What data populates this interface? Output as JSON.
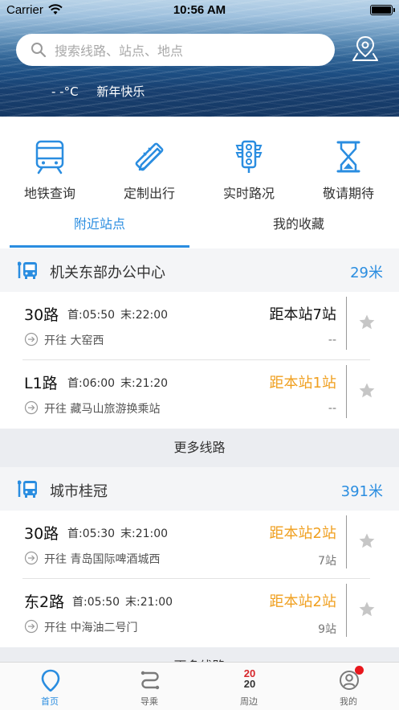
{
  "status_bar": {
    "carrier": "Carrier",
    "time": "10:56 AM"
  },
  "header": {
    "search_placeholder": "搜索线路、站点、地点",
    "temperature": "- -°C",
    "greeting": "新年快乐"
  },
  "quick_actions": [
    {
      "label": "地铁查询",
      "icon": "subway-icon"
    },
    {
      "label": "定制出行",
      "icon": "ruler-pencil-icon"
    },
    {
      "label": "实时路况",
      "icon": "traffic-light-icon"
    },
    {
      "label": "敬请期待",
      "icon": "hourglass-icon"
    }
  ],
  "tabs": [
    {
      "label": "附近站点",
      "active": true
    },
    {
      "label": "我的收藏",
      "active": false
    }
  ],
  "stations": [
    {
      "name": "机关东部办公中心",
      "distance": "29米",
      "routes": [
        {
          "name": "30路",
          "first_prefix": "首:",
          "first": "05:50",
          "last_prefix": "末:",
          "last": "22:00",
          "direction_prefix": "开往",
          "direction": "大窑西",
          "away": "距本站7站",
          "away_color": "black",
          "stops": "--"
        },
        {
          "name": "L1路",
          "first_prefix": "首:",
          "first": "06:00",
          "last_prefix": "末:",
          "last": "21:20",
          "direction_prefix": "开往",
          "direction": "藏马山旅游换乘站",
          "away": "距本站1站",
          "away_color": "orange",
          "stops": "--"
        }
      ],
      "more_label": "更多线路"
    },
    {
      "name": "城市桂冠",
      "distance": "391米",
      "routes": [
        {
          "name": "30路",
          "first_prefix": "首:",
          "first": "05:30",
          "last_prefix": "末:",
          "last": "21:00",
          "direction_prefix": "开往",
          "direction": "青岛国际啤酒城西",
          "away": "距本站2站",
          "away_color": "orange",
          "stops": "7站"
        },
        {
          "name": "东2路",
          "first_prefix": "首:",
          "first": "05:50",
          "last_prefix": "末:",
          "last": "21:00",
          "direction_prefix": "开往",
          "direction": "中海油二号门",
          "away": "距本站2站",
          "away_color": "orange",
          "stops": "9站"
        }
      ],
      "more_label": "更多线路"
    }
  ],
  "tab_bar": [
    {
      "label": "首页",
      "icon": "home-location-icon",
      "active": true
    },
    {
      "label": "导乘",
      "icon": "route-guide-icon",
      "active": false
    },
    {
      "label": "周边",
      "icon": "year-2020-icon",
      "icon_text_top": "20",
      "icon_text_bottom": "20",
      "active": false
    },
    {
      "label": "我的",
      "icon": "user-icon",
      "active": false,
      "badge": true
    }
  ],
  "colors": {
    "accent": "#2a8de0",
    "orange": "#f0a020",
    "badge": "#e8171d"
  }
}
